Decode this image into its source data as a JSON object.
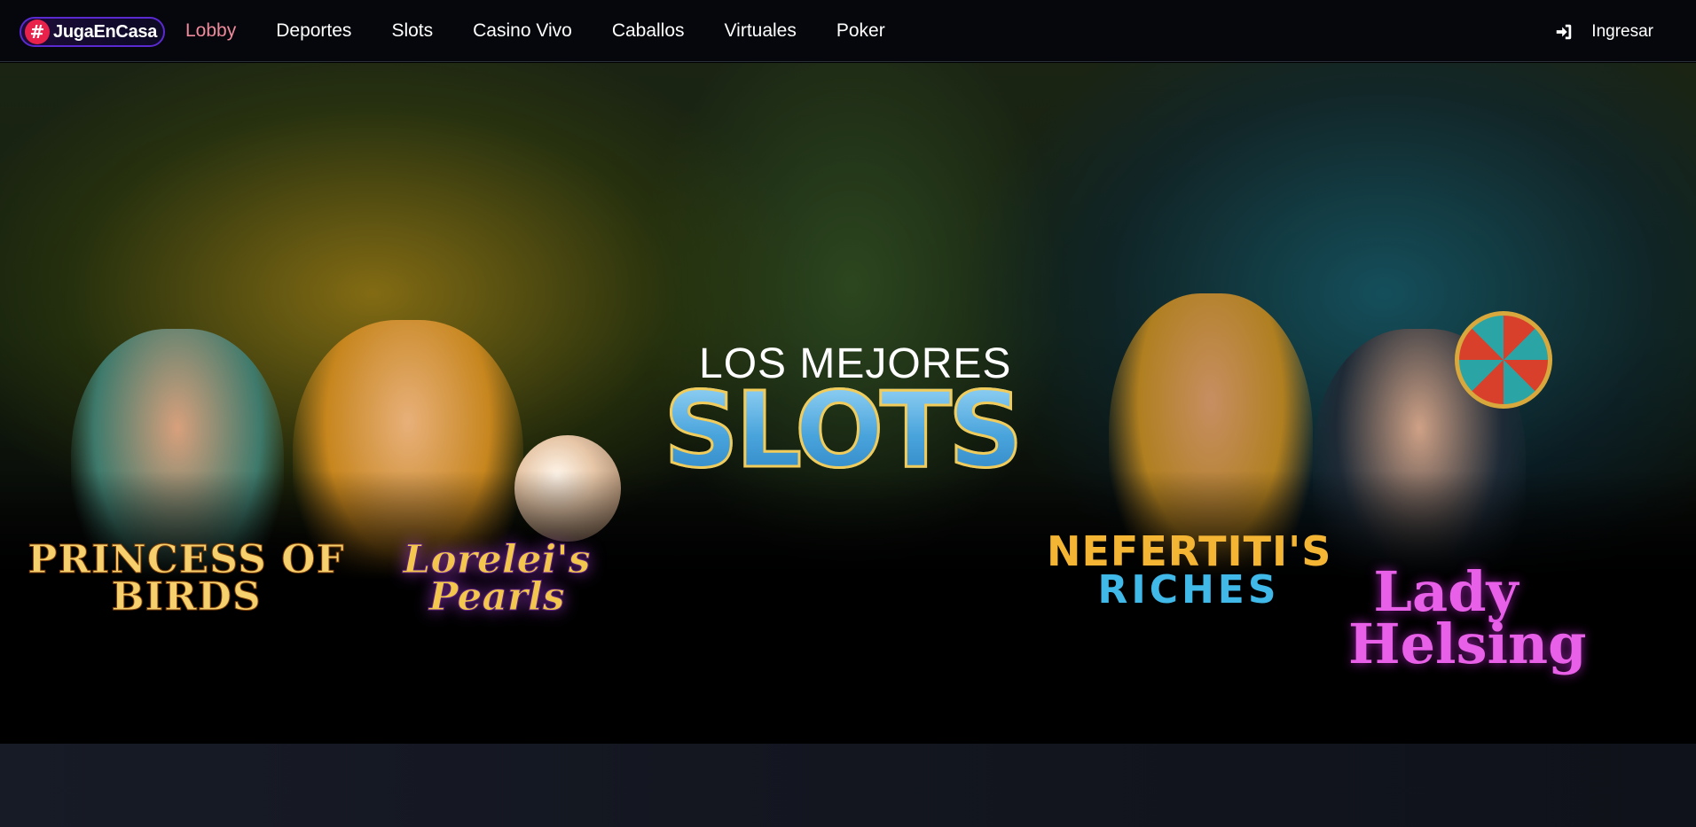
{
  "header": {
    "logo": {
      "hash": "#",
      "text": "JugaEnCasa"
    },
    "nav": [
      {
        "label": "Lobby",
        "active": true
      },
      {
        "label": "Deportes",
        "active": false
      },
      {
        "label": "Slots",
        "active": false
      },
      {
        "label": "Casino Vivo",
        "active": false
      },
      {
        "label": "Caballos",
        "active": false
      },
      {
        "label": "Virtuales",
        "active": false
      },
      {
        "label": "Poker",
        "active": false
      }
    ],
    "login_label": "Ingresar",
    "login_icon": "sign-in-icon"
  },
  "hero": {
    "kicker": "LOS MEJORES",
    "title": "SLOTS",
    "games": [
      {
        "name": "PRINCESS OF BIRDS"
      },
      {
        "name": "Lorelei's Pearls"
      },
      {
        "name": "NEFERTITI'S",
        "sub": "RICHES"
      },
      {
        "name": "Lady Helsing"
      }
    ]
  },
  "colors": {
    "active_nav": "#ef8a9c",
    "logo_hash_bg": "#e8224b",
    "logo_border": "#5a2ad0",
    "page_bg": "#000000"
  }
}
